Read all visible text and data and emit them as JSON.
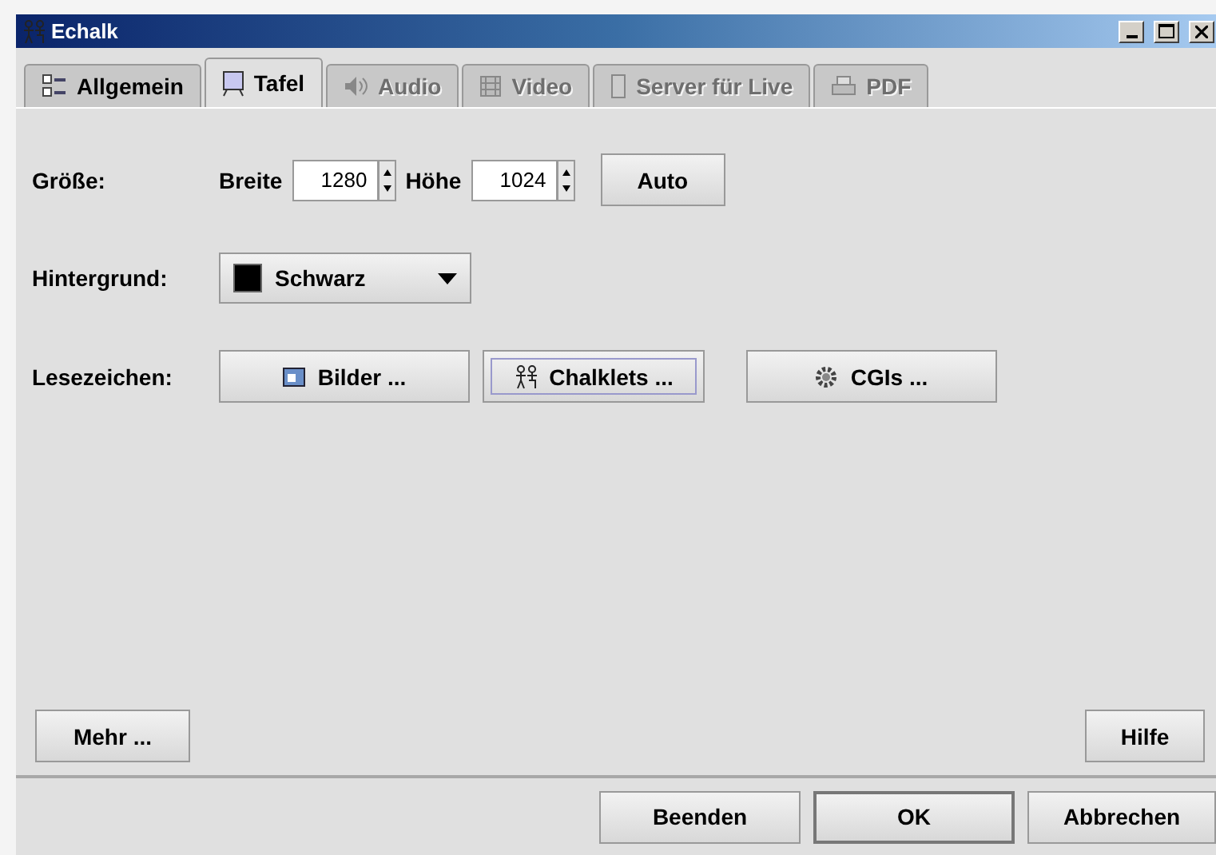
{
  "window": {
    "title": "Echalk"
  },
  "tabs": [
    {
      "label": "Allgemein",
      "kind": "checklist",
      "selected": false,
      "disabled": false
    },
    {
      "label": "Tafel",
      "kind": "board",
      "selected": true,
      "disabled": false
    },
    {
      "label": "Audio",
      "kind": "speaker",
      "selected": false,
      "disabled": true
    },
    {
      "label": "Video",
      "kind": "film",
      "selected": false,
      "disabled": true
    },
    {
      "label": "Server für Live",
      "kind": "server",
      "selected": false,
      "disabled": true
    },
    {
      "label": "PDF",
      "kind": "printer",
      "selected": false,
      "disabled": true
    }
  ],
  "size": {
    "label": "Größe:",
    "width_label": "Breite",
    "width_value": "1280",
    "height_label": "Höhe",
    "height_value": "1024",
    "auto_button": "Auto"
  },
  "background": {
    "label": "Hintergrund:",
    "value": "Schwarz",
    "color": "#000000"
  },
  "bookmarks": {
    "label": "Lesezeichen:",
    "buttons": [
      {
        "label": "Bilder ...",
        "kind": "image",
        "focused": false
      },
      {
        "label": "Chalklets ...",
        "kind": "figure",
        "focused": true
      },
      {
        "label": "CGIs ...",
        "kind": "gear",
        "focused": false
      }
    ]
  },
  "more_button": "Mehr ...",
  "help_button": "Hilfe",
  "actions": [
    {
      "label": "Beenden",
      "default": false
    },
    {
      "label": "OK",
      "default": true
    },
    {
      "label": "Abbrechen",
      "default": false
    }
  ]
}
